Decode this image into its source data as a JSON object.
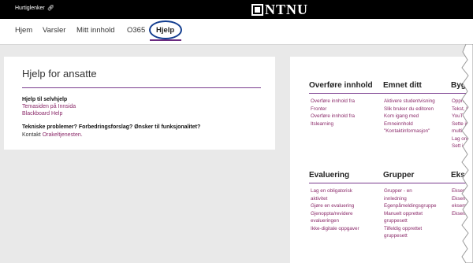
{
  "topbar": {
    "quick_links": "Hurtiglenker",
    "logo_text": "NTNU"
  },
  "nav": {
    "items": [
      "Hjem",
      "Varsler",
      "Mitt innhold",
      "O365",
      "Hjelp"
    ],
    "active": "Hjelp"
  },
  "left_card": {
    "title": "Hjelp for ansatte",
    "section1_heading": "Hjelp til selvhjelp",
    "section1_links": [
      "Temasiden på Innsida",
      "Blackboard Help"
    ],
    "section2_heading": "Tekniske problemer? Forbedringsforslag? Ønsker til funksjonalitet?",
    "section2_prefix": "Kontakt",
    "section2_link": "Orakeltjenesten."
  },
  "right_card": {
    "columns_row1": [
      {
        "heading": "Overføre innhold",
        "items": [
          "Overføre innhold fra",
          "Fronter",
          "Overføre innhold fra",
          "Itslearning"
        ]
      },
      {
        "heading": "Emnet ditt",
        "items": [
          "Aktivere studentvisning",
          "Slik bruker du editoren",
          "Kom igang med",
          "Emneinnhold",
          "\"Kontaktinformasjon\""
        ]
      },
      {
        "heading": "Bygg n",
        "items": [
          "Oppret",
          "Tekst, b",
          "YouTu",
          "Sette in",
          "multimed",
          "Lag one",
          "Sett inn"
        ]
      }
    ],
    "columns_row2": [
      {
        "heading": "Evaluering",
        "items": [
          "Lag en obligatorisk",
          "aktivitet",
          "Gjøre en evaluering",
          "Gjenoppta/revidere",
          "evalueringen",
          "Ikke-digitale oppgaver"
        ]
      },
      {
        "heading": "Grupper",
        "items": [
          "Grupper - en",
          "innledning",
          "Egenpåmeldingsgruppe",
          "Manuelt opprettet",
          "gruppesett",
          "Tilfeldig opprettet",
          "gruppesett"
        ]
      },
      {
        "heading": "Eksen",
        "items": [
          "Eksem",
          "Eksem",
          "eksem",
          "Eksem"
        ]
      }
    ]
  }
}
